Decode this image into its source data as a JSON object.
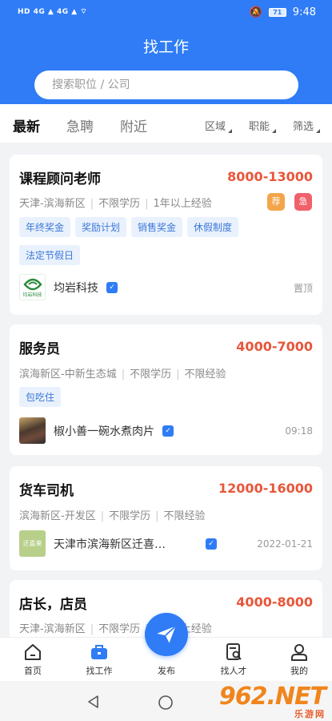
{
  "status_bar": {
    "left": "HD 4G ▲ 4G ▲ ⌔",
    "battery": "71",
    "time": "9:48"
  },
  "header": {
    "title": "找工作",
    "search_placeholder": "搜索职位 / 公司"
  },
  "tabs": [
    "最新",
    "急聘",
    "附近"
  ],
  "filters": [
    "区域",
    "职能",
    "筛选"
  ],
  "jobs": [
    {
      "title": "课程顾问老师",
      "salary": "8000-13000",
      "meta": [
        "天津-滨海新区",
        "不限学历",
        "1年以上经验"
      ],
      "badges": [
        "荐",
        "急"
      ],
      "tags": [
        "年终奖金",
        "奖励计划",
        "销售奖金",
        "休假制度",
        "法定节假日"
      ],
      "company": "均岩科技",
      "logo_text": "均岩科技",
      "note": "置顶"
    },
    {
      "title": "服务员",
      "salary": "4000-7000",
      "meta": [
        "滨海新区-中新生态城",
        "不限学历",
        "不限经验"
      ],
      "tags": [
        "包吃住"
      ],
      "company": "椒小善一碗水煮肉片",
      "note": "09:18"
    },
    {
      "title": "货车司机",
      "salary": "12000-16000",
      "meta": [
        "滨海新区-开发区",
        "不限学历",
        "不限经验"
      ],
      "company": "天津市滨海新区迁喜…",
      "logo_text": "迁喜来",
      "note": "2022-01-21"
    },
    {
      "title": "店长，店员",
      "salary": "4000-8000",
      "meta": [
        "天津-滨海新区",
        "不限学历",
        "1年以上经验"
      ]
    }
  ],
  "bottom_nav": {
    "home": "首页",
    "find_job": "找工作",
    "publish": "发布",
    "find_talent": "找人才",
    "mine": "我的"
  },
  "watermark": {
    "main": "962.NET",
    "sub": "乐游网"
  },
  "colors": {
    "primary": "#2f7cf6",
    "salary": "#e8563a",
    "tag_bg": "#e9f1fd",
    "tag_text": "#3d79d6"
  }
}
